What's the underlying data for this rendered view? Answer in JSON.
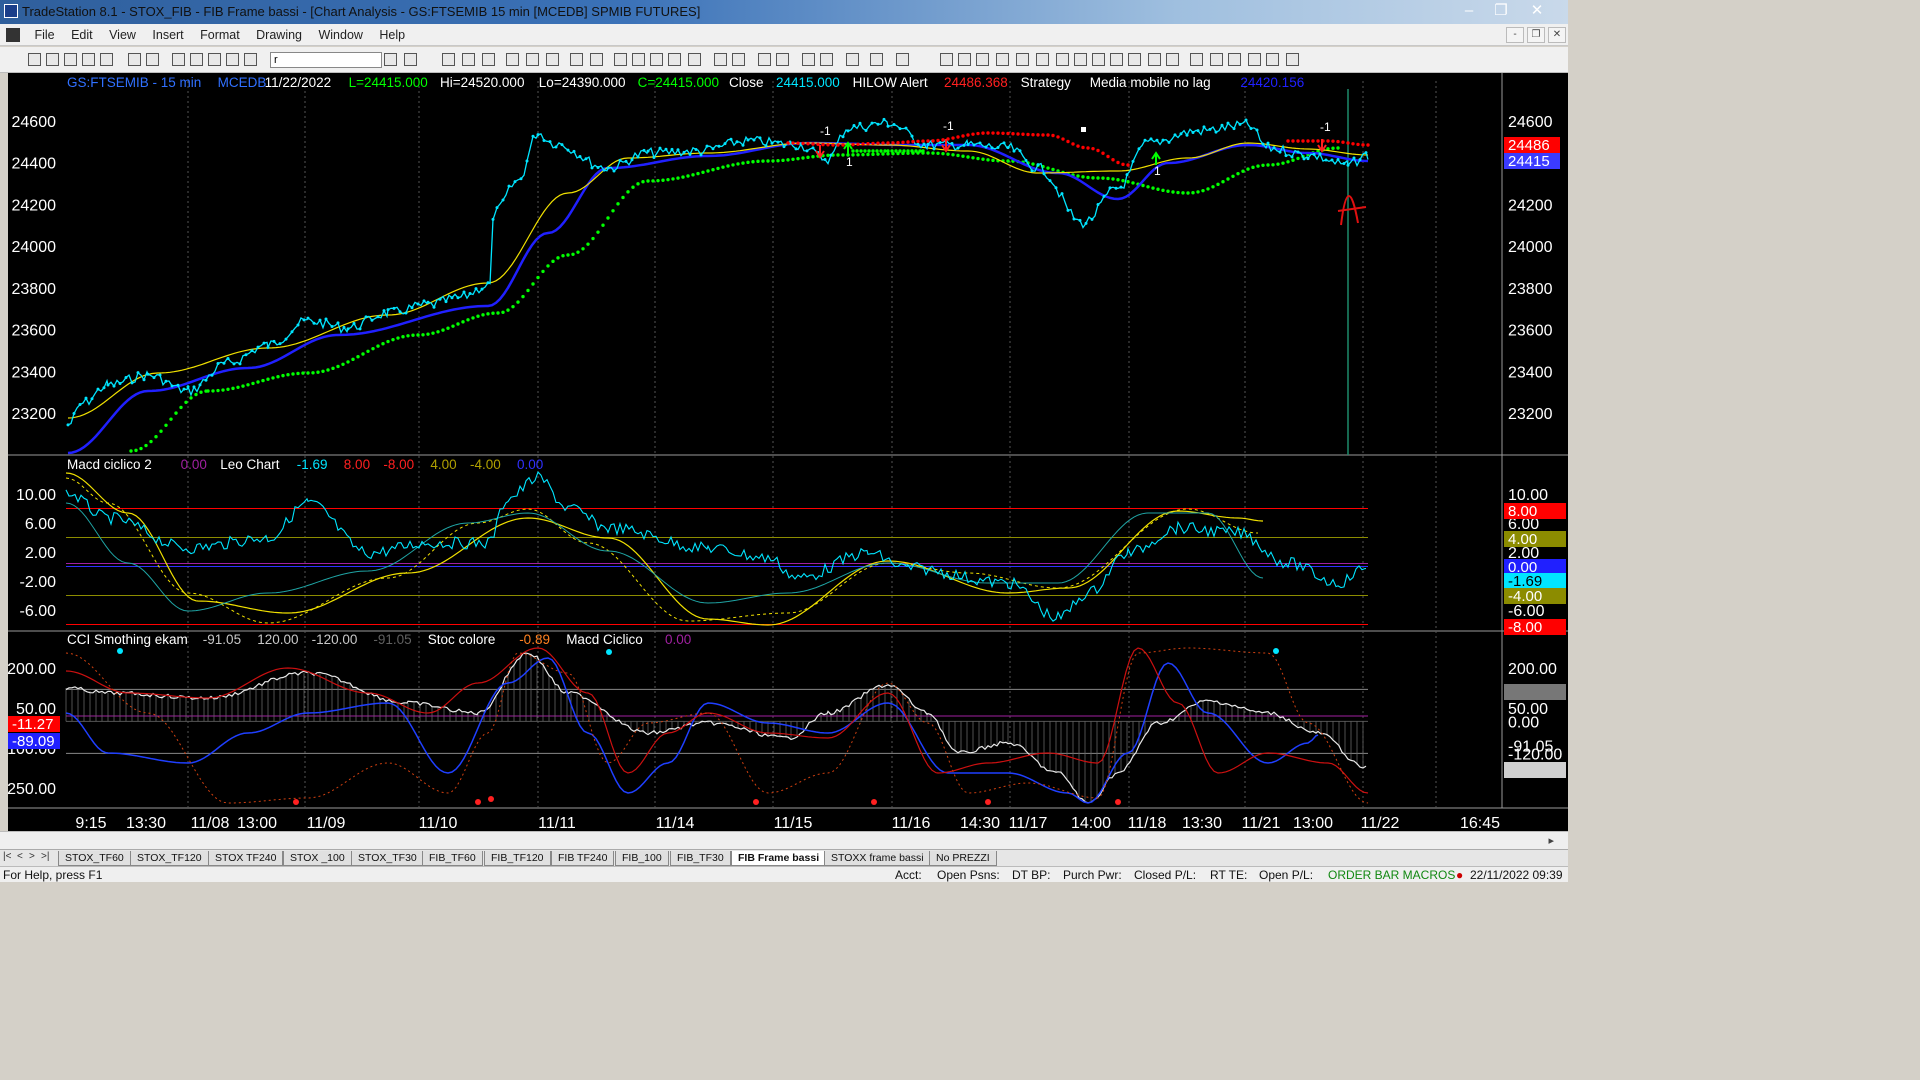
{
  "window": {
    "title": "TradeStation 8.1 - STOX_FIB - FIB Frame bassi - [Chart Analysis - GS:FTSEMIB  15 min  [MCEDB] SPMIB FUTURES]",
    "controls": {
      "minimize": "–",
      "maximize": "❐",
      "close": "✕"
    }
  },
  "menu": {
    "items": [
      "File",
      "Edit",
      "View",
      "Insert",
      "Format",
      "Drawing",
      "Window",
      "Help"
    ],
    "mdi_controls": [
      "-",
      "❐",
      "✕"
    ]
  },
  "toolbar": {
    "symbol_value": "r"
  },
  "chart": {
    "colors": {
      "price": "#00e5ff",
      "sma": "#2020ff",
      "ema_slow": "#00ff00",
      "ema_fast": "#f0e000",
      "alert_red": "#ff0000",
      "axis_text": "#ffffff"
    },
    "header": [
      {
        "text": "GS:FTSEMIB - 15 min",
        "color": "#3070ff"
      },
      {
        "text": "MCEDB",
        "color": "#3070ff"
      },
      {
        "text": "11/22/2022",
        "color": "#ffffff"
      },
      {
        "text": "L=24415.000",
        "color": "#00ff00"
      },
      {
        "text": "Hi=24520.000",
        "color": "#ffffff"
      },
      {
        "text": "Lo=24390.000",
        "color": "#ffffff"
      },
      {
        "text": "C=24415.000",
        "color": "#00ff00"
      },
      {
        "text": "Close",
        "color": "#ffffff"
      },
      {
        "text": "24415.000",
        "color": "#00e5ff"
      },
      {
        "text": "HILOW Alert",
        "color": "#ffffff"
      },
      {
        "text": "24486.368",
        "color": "#ff2020"
      },
      {
        "text": "Strategy",
        "color": "#ffffff"
      },
      {
        "text": "Media mobile no lag",
        "color": "#ffffff"
      },
      {
        "text": "24420.156",
        "color": "#2020ff"
      }
    ],
    "price_axis": [
      "24600",
      "24400",
      "24200",
      "24000",
      "23800",
      "23600",
      "23400",
      "23200"
    ],
    "price_badges": [
      {
        "text": "24486",
        "bg": "#ff0000",
        "fg": "#ffffff"
      },
      {
        "text": "24415",
        "bg": "#3b3bff",
        "fg": "#ffffff"
      }
    ],
    "trade_marks": [
      "-1",
      "1",
      "-1",
      "-1",
      "1"
    ],
    "macd_panel": {
      "header": [
        {
          "text": "Macd ciclico 2",
          "color": "#ffffff"
        },
        {
          "text": "0.00",
          "color": "#a020a0"
        },
        {
          "text": "Leo Chart",
          "color": "#ffffff"
        },
        {
          "text": "-1.69",
          "color": "#00e5ff"
        },
        {
          "text": "8.00",
          "color": "#ff2020"
        },
        {
          "text": "-8.00",
          "color": "#ff2020"
        },
        {
          "text": "4.00",
          "color": "#b0a000"
        },
        {
          "text": "-4.00",
          "color": "#b0a000"
        },
        {
          "text": "0.00",
          "color": "#3030ff"
        }
      ],
      "axis": [
        "10.00",
        "6.00",
        "2.00",
        "-2.00",
        "-6.00"
      ],
      "badges": [
        {
          "text": "8.00",
          "bg": "#ff0000",
          "fg": "#ffffff"
        },
        {
          "text": "4.00",
          "bg": "#8c8c00",
          "fg": "#ffffff"
        },
        {
          "text": "0.00",
          "bg": "#2020ff",
          "fg": "#ffffff"
        },
        {
          "text": "-1.69",
          "bg": "#00e5ff",
          "fg": "#000000"
        },
        {
          "text": "-4.00",
          "bg": "#8c8c00",
          "fg": "#ffffff"
        },
        {
          "text": "-8.00",
          "bg": "#ff0000",
          "fg": "#ffffff"
        }
      ]
    },
    "cci_panel": {
      "header": [
        {
          "text": "CCI Smothing ekam",
          "color": "#ffffff"
        },
        {
          "text": "-91.05",
          "color": "#c8c8c8"
        },
        {
          "text": "120.00",
          "color": "#c8c8c8"
        },
        {
          "text": "-120.00",
          "color": "#c8c8c8"
        },
        {
          "text": "-91.05",
          "color": "#606060"
        },
        {
          "text": "Stoc colore",
          "color": "#ffffff"
        },
        {
          "text": "-0.89",
          "color": "#ff8020"
        },
        {
          "text": "Macd Ciclico",
          "color": "#ffffff"
        },
        {
          "text": "0.00",
          "color": "#a020a0"
        }
      ],
      "axis": [
        "200.00",
        "50.00",
        "-100.00",
        "-250.00"
      ],
      "right_axis": [
        "200.00",
        "120.00",
        "50.00",
        "0.00",
        "-91.05",
        "-120.00"
      ],
      "left_badges": [
        {
          "text": "-11.27",
          "bg": "#ff0000",
          "fg": "#ffffff"
        },
        {
          "text": "-89.09",
          "bg": "#2020ff",
          "fg": "#ffffff"
        }
      ]
    },
    "time_axis": [
      "9:15",
      "13:30",
      "11/08",
      "13:00",
      "11/09",
      "11/10",
      "11/11",
      "11/14",
      "11/15",
      "11/16",
      "14:30",
      "11/17",
      "14:00",
      "11/18",
      "13:30",
      "11/21",
      "13:00",
      "11/22",
      "16:45"
    ]
  },
  "tabs": [
    "STOX_TF60",
    "STOX_TF120",
    "STOX TF240",
    "STOX _100",
    "STOX_TF30",
    "FIB_TF60",
    "FIB_TF120",
    "FIB TF240",
    "FIB_100",
    "FIB_TF30",
    "FIB Frame bassi",
    "STOXX frame bassi",
    "No PREZZI"
  ],
  "active_tab": "FIB Frame bassi",
  "status": {
    "help": "For Help, press F1",
    "fields": [
      "Acct:",
      "Open Psns:",
      "DT BP:",
      "Purch Pwr:",
      "Closed P/L:",
      "RT TE:",
      "Open P/L:"
    ],
    "macros": "ORDER BAR MACROS",
    "datetime": "22/11/2022 09:39"
  }
}
